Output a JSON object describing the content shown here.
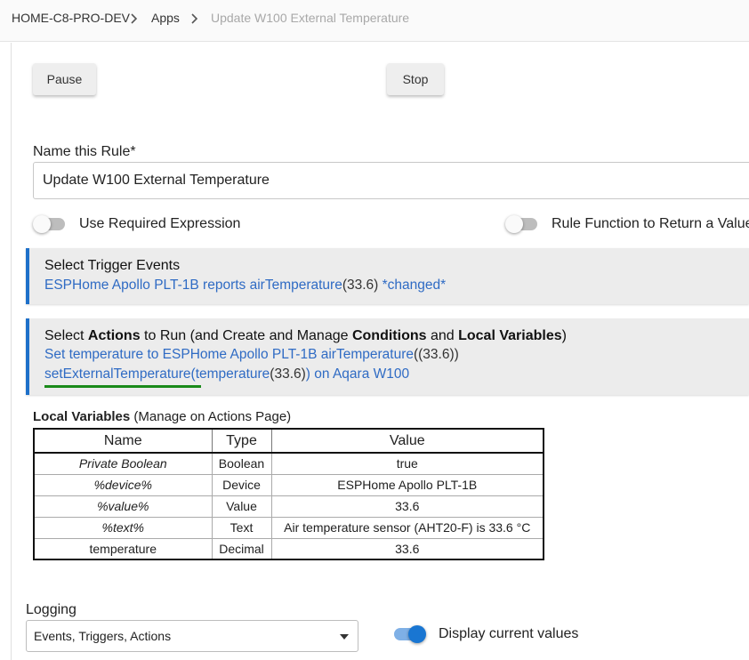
{
  "breadcrumb": {
    "hub": "HOME-C8-PRO-DEV",
    "apps": "Apps",
    "current": "Update W100 External Temperature"
  },
  "buttons": {
    "pause": "Pause",
    "stop": "Stop"
  },
  "rule_name": {
    "label": "Name this Rule*",
    "value": "Update W100 External Temperature"
  },
  "toggles": {
    "required_expression": {
      "label": "Use Required Expression",
      "on": false
    },
    "return_value": {
      "label": "Rule Function to Return a Value",
      "on": false
    }
  },
  "trigger_panel": {
    "title": "Select Trigger Events",
    "line_prefix": "ESPHome Apollo PLT-1B reports airTemperature",
    "line_value": "(33.6)",
    "line_suffix": " *changed*"
  },
  "actions_panel": {
    "title_1": "Select ",
    "title_bold_1": "Actions",
    "title_2": " to Run (and Create and Manage ",
    "title_bold_2": "Conditions",
    "title_3": " and ",
    "title_bold_3": "Local Variables",
    "title_4": ")",
    "action_1_prefix": "Set temperature to ESPHome Apollo PLT-1B airTemperature",
    "action_1_value": "((33.6))",
    "action_2_prefix": "setExternalTemperature(temperature",
    "action_2_value": "(33.6)",
    "action_2_suffix": ") on Aqara W100"
  },
  "local_variables": {
    "title": "Local Variables",
    "subtitle": " (Manage on Actions Page)",
    "columns": [
      "Name",
      "Type",
      "Value"
    ],
    "rows": [
      {
        "name": "Private Boolean",
        "type": "Boolean",
        "value": "true"
      },
      {
        "name": "%device%",
        "type": "Device",
        "value": "ESPHome Apollo PLT-1B"
      },
      {
        "name": "%value%",
        "type": "Value",
        "value": "33.6"
      },
      {
        "name": "%text%",
        "type": "Text",
        "value": "Air temperature sensor (AHT20-F) is 33.6 °C"
      },
      {
        "name": "temperature",
        "type": "Decimal",
        "value": "33.6"
      }
    ]
  },
  "logging": {
    "label": "Logging",
    "selected": "Events, Triggers, Actions"
  },
  "display_values": {
    "label": "Display current values",
    "on": true
  },
  "colors": {
    "link_blue": "#2f6bc4",
    "panel_accent": "#1e70c9",
    "underline_green": "#1a8a1a",
    "toggle_on": "#1976d2"
  }
}
